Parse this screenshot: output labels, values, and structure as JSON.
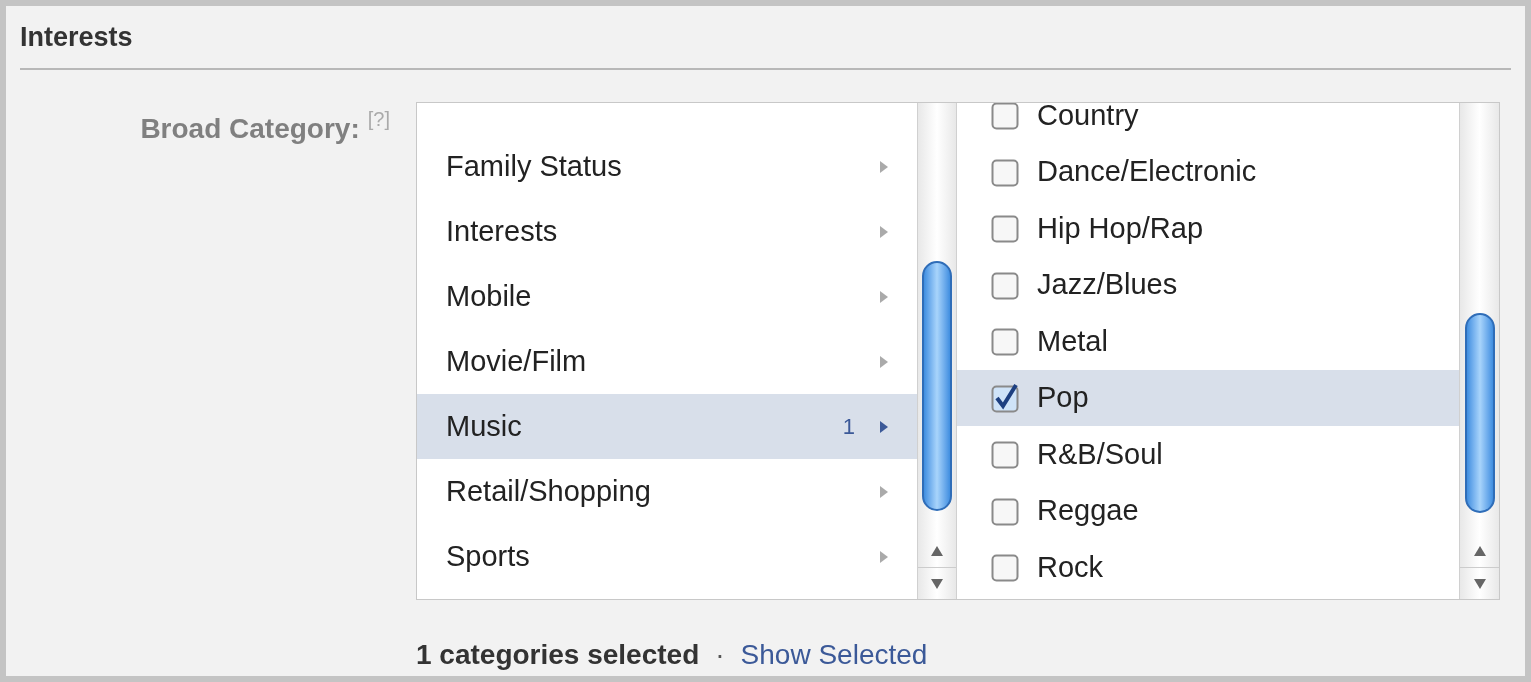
{
  "section": {
    "title": "Interests"
  },
  "field": {
    "label": "Broad Category:",
    "help": "[?]"
  },
  "categories": [
    {
      "label": "Family Status",
      "selected": false
    },
    {
      "label": "Interests",
      "selected": false
    },
    {
      "label": "Mobile",
      "selected": false
    },
    {
      "label": "Movie/Film",
      "selected": false
    },
    {
      "label": "Music",
      "count": "1",
      "selected": true
    },
    {
      "label": "Retail/Shopping",
      "selected": false
    },
    {
      "label": "Sports",
      "selected": false
    }
  ],
  "subcategories": [
    {
      "label": "Country",
      "checked": false,
      "selected": false
    },
    {
      "label": "Dance/Electronic",
      "checked": false,
      "selected": false
    },
    {
      "label": "Hip Hop/Rap",
      "checked": false,
      "selected": false
    },
    {
      "label": "Jazz/Blues",
      "checked": false,
      "selected": false
    },
    {
      "label": "Metal",
      "checked": false,
      "selected": false
    },
    {
      "label": "Pop",
      "checked": true,
      "selected": true
    },
    {
      "label": "R&B/Soul",
      "checked": false,
      "selected": false
    },
    {
      "label": "Reggae",
      "checked": false,
      "selected": false
    },
    {
      "label": "Rock",
      "checked": false,
      "selected": false
    }
  ],
  "footer": {
    "summary": "1 categories selected",
    "separator": "·",
    "link": "Show Selected"
  }
}
